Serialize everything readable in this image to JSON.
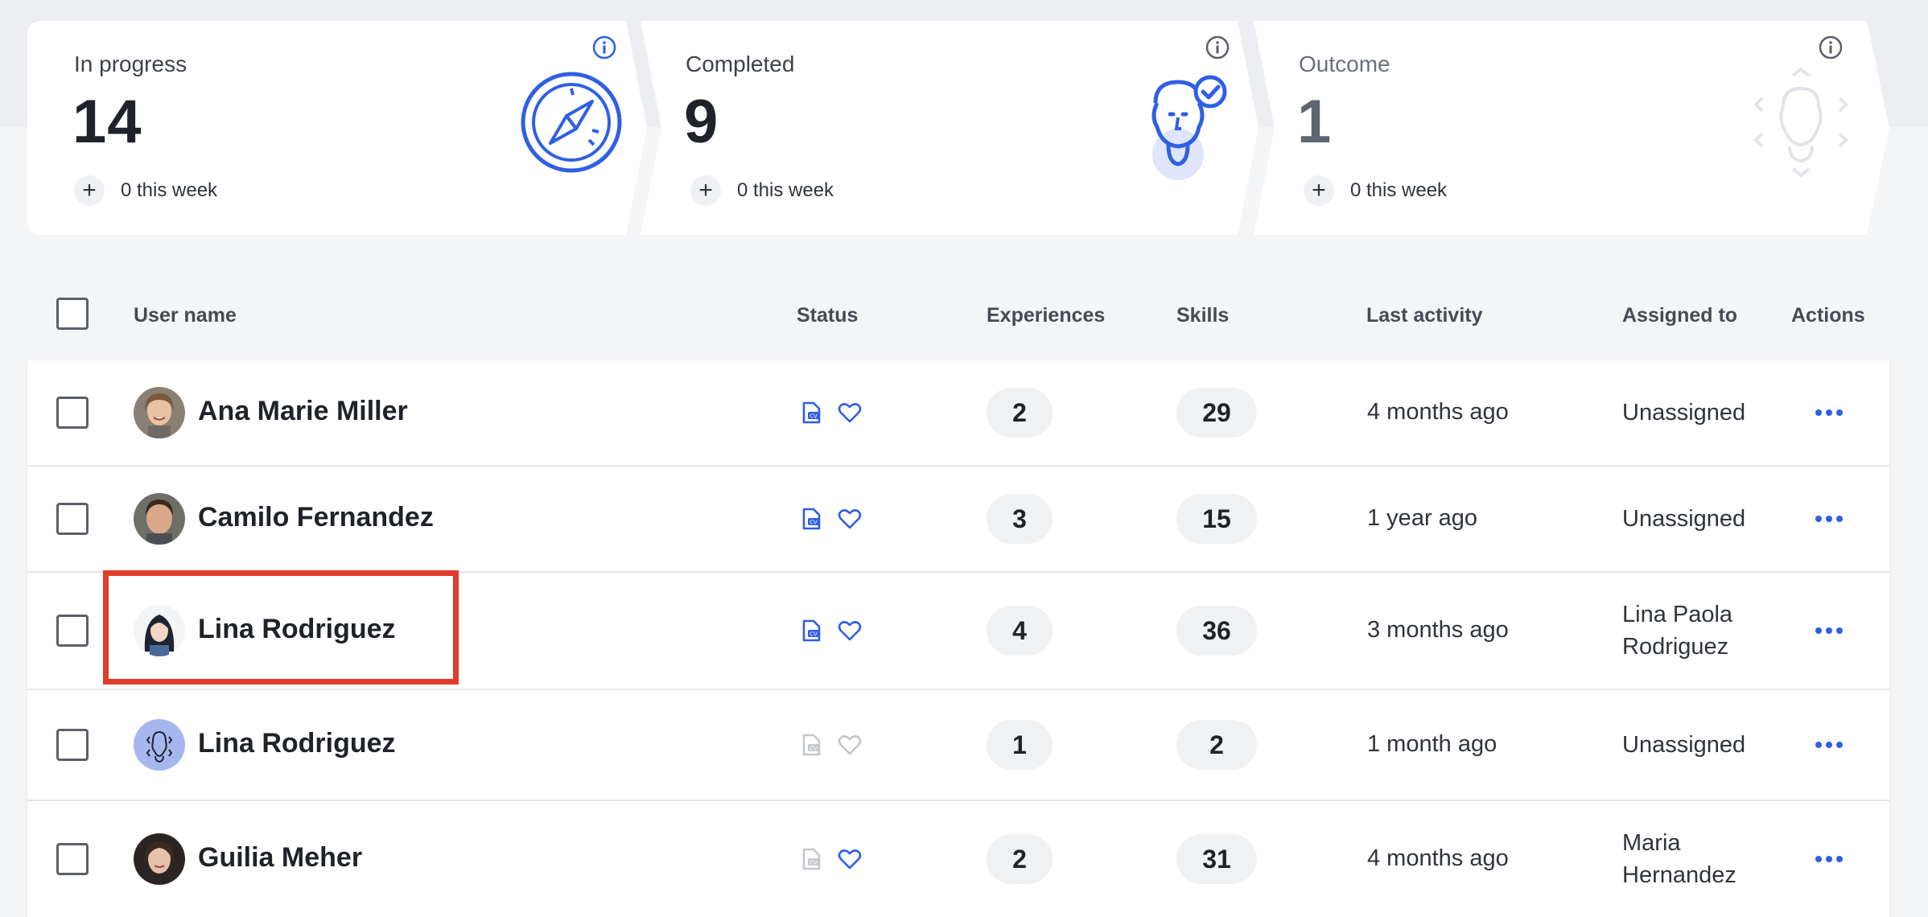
{
  "colors": {
    "accent": "#2f5fe3",
    "highlight": "#e33b2b",
    "muted_icon": "#c4c7cc"
  },
  "cards": [
    {
      "label": "In progress",
      "value": "14",
      "week": "0 this week",
      "icon": "compass-icon"
    },
    {
      "label": "Completed",
      "value": "9",
      "week": "0 this week",
      "icon": "person-check-icon"
    },
    {
      "label": "Outcome",
      "value": "1",
      "week": "0 this week",
      "icon": "face-scan-icon"
    }
  ],
  "table": {
    "headers": {
      "user_name": "User name",
      "status": "Status",
      "experiences": "Experiences",
      "skills": "Skills",
      "last_activity": "Last activity",
      "assigned_to": "Assigned to",
      "actions": "Actions"
    },
    "rows": [
      {
        "name": "Ana Marie Miller",
        "status_resume": "active",
        "status_favorite": "active",
        "experiences": "2",
        "skills": "29",
        "last_activity": "4 months ago",
        "assigned_to": "Unassigned"
      },
      {
        "name": "Camilo Fernandez",
        "status_resume": "active",
        "status_favorite": "active",
        "experiences": "3",
        "skills": "15",
        "last_activity": "1 year ago",
        "assigned_to": "Unassigned"
      },
      {
        "name": "Lina Rodriguez",
        "status_resume": "active",
        "status_favorite": "active",
        "experiences": "4",
        "skills": "36",
        "last_activity": "3 months ago",
        "assigned_to": "Lina Paola Rodriguez"
      },
      {
        "name": "Lina Rodriguez",
        "status_resume": "inactive",
        "status_favorite": "inactive",
        "experiences": "1",
        "skills": "2",
        "last_activity": "1 month ago",
        "assigned_to": "Unassigned"
      },
      {
        "name": "Guilia Meher",
        "status_resume": "inactive",
        "status_favorite": "active",
        "experiences": "2",
        "skills": "31",
        "last_activity": "4 months ago",
        "assigned_to": "Maria Hernandez"
      }
    ]
  }
}
